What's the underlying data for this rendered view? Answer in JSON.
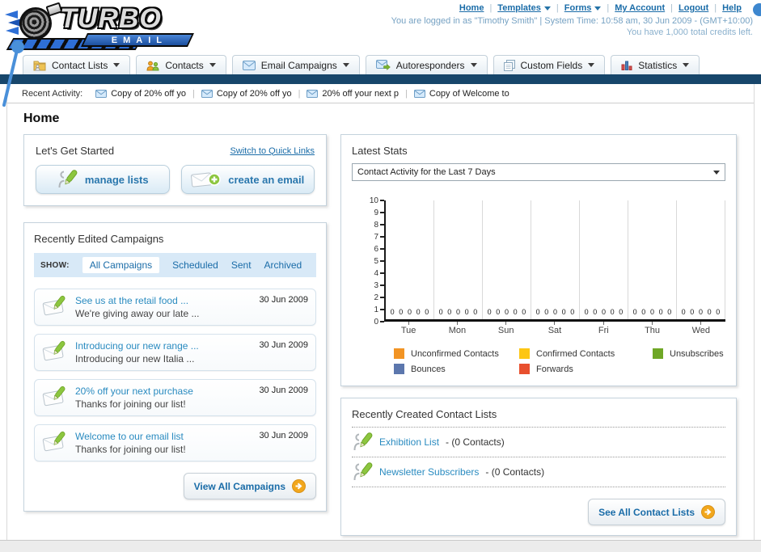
{
  "brand": {
    "name": "TURBO",
    "sub": "EMAIL"
  },
  "header": {
    "nav": [
      {
        "label": "Home",
        "dropdown": false
      },
      {
        "label": "Templates",
        "dropdown": true
      },
      {
        "label": "Forms",
        "dropdown": true
      },
      {
        "label": "My Account",
        "dropdown": false
      },
      {
        "label": "Logout",
        "dropdown": false
      },
      {
        "label": "Help",
        "dropdown": false
      }
    ],
    "login_line": "You are logged in as \"Timothy Smith\" | System Time: 10:58 am, 30 Jun 2009 - (GMT+10:00)",
    "credits_line": "You have 1,000 total credits left."
  },
  "tabs": [
    {
      "label": "Contact Lists",
      "icon": "folder-contact-icon"
    },
    {
      "label": "Contacts",
      "icon": "people-icon"
    },
    {
      "label": "Email Campaigns",
      "icon": "envelope-icon"
    },
    {
      "label": "Autoresponders",
      "icon": "envelope-arrow-icon"
    },
    {
      "label": "Custom Fields",
      "icon": "pages-icon"
    },
    {
      "label": "Statistics",
      "icon": "bar-chart-icon"
    }
  ],
  "recent_activity": {
    "label": "Recent Activity:",
    "items": [
      "Copy of 20% off yo",
      "Copy of 20% off yo",
      "20% off your next p",
      "Copy of Welcome to"
    ]
  },
  "page_title": "Home",
  "get_started": {
    "title": "Let's Get Started",
    "switch_link": "Switch to Quick Links",
    "buttons": [
      {
        "label": "manage lists",
        "icon": "person-pencil-icon"
      },
      {
        "label": "create an email",
        "icon": "envelope-plus-icon"
      }
    ]
  },
  "campaigns": {
    "title": "Recently Edited Campaigns",
    "show_label": "SHOW:",
    "filters": [
      {
        "label": "All Campaigns",
        "active": true
      },
      {
        "label": "Scheduled",
        "active": false
      },
      {
        "label": "Sent",
        "active": false
      },
      {
        "label": "Archived",
        "active": false
      }
    ],
    "items": [
      {
        "title": "See us at the retail food ...",
        "subtitle": "We're giving away our late ...",
        "date": "30 Jun 2009"
      },
      {
        "title": "Introducing our new range ...",
        "subtitle": "Introducing our new Italia ...",
        "date": "30 Jun 2009"
      },
      {
        "title": "20% off your next purchase",
        "subtitle": "Thanks for joining our list!",
        "date": "30 Jun 2009"
      },
      {
        "title": "Welcome to our email list",
        "subtitle": "Thanks for joining our list!",
        "date": "30 Jun 2009"
      }
    ],
    "view_all_label": "View All Campaigns"
  },
  "stats": {
    "title": "Latest Stats",
    "dropdown_value": "Contact Activity for the Last 7 Days"
  },
  "chart_data": {
    "type": "bar",
    "title": "Contact Activity for the Last 7 Days",
    "categories": [
      "Tue",
      "Mon",
      "Sun",
      "Sat",
      "Fri",
      "Thu",
      "Wed"
    ],
    "series": [
      {
        "name": "Unconfirmed Contacts",
        "color": "#f29424",
        "values": [
          0,
          0,
          0,
          0,
          0,
          0,
          0
        ]
      },
      {
        "name": "Confirmed Contacts",
        "color": "#fdc613",
        "values": [
          0,
          0,
          0,
          0,
          0,
          0,
          0
        ]
      },
      {
        "name": "Unsubscribes",
        "color": "#6fa726",
        "values": [
          0,
          0,
          0,
          0,
          0,
          0,
          0
        ]
      },
      {
        "name": "Bounces",
        "color": "#5c77ad",
        "values": [
          0,
          0,
          0,
          0,
          0,
          0,
          0
        ]
      },
      {
        "name": "Forwards",
        "color": "#e8502e",
        "values": [
          0,
          0,
          0,
          0,
          0,
          0,
          0
        ]
      }
    ],
    "xlabel": "",
    "ylabel": "",
    "ylim": [
      0,
      10
    ],
    "ytick_step": 1,
    "grid": true,
    "legend_position": "bottom",
    "value_labels_shown": true
  },
  "contact_lists": {
    "title": "Recently Created Contact Lists",
    "items": [
      {
        "name": "Exhibition List",
        "suffix": " - (0 Contacts)"
      },
      {
        "name": "Newsletter Subscribers",
        "suffix": " - (0 Contacts)"
      }
    ],
    "see_all_label": "See All Contact Lists"
  }
}
